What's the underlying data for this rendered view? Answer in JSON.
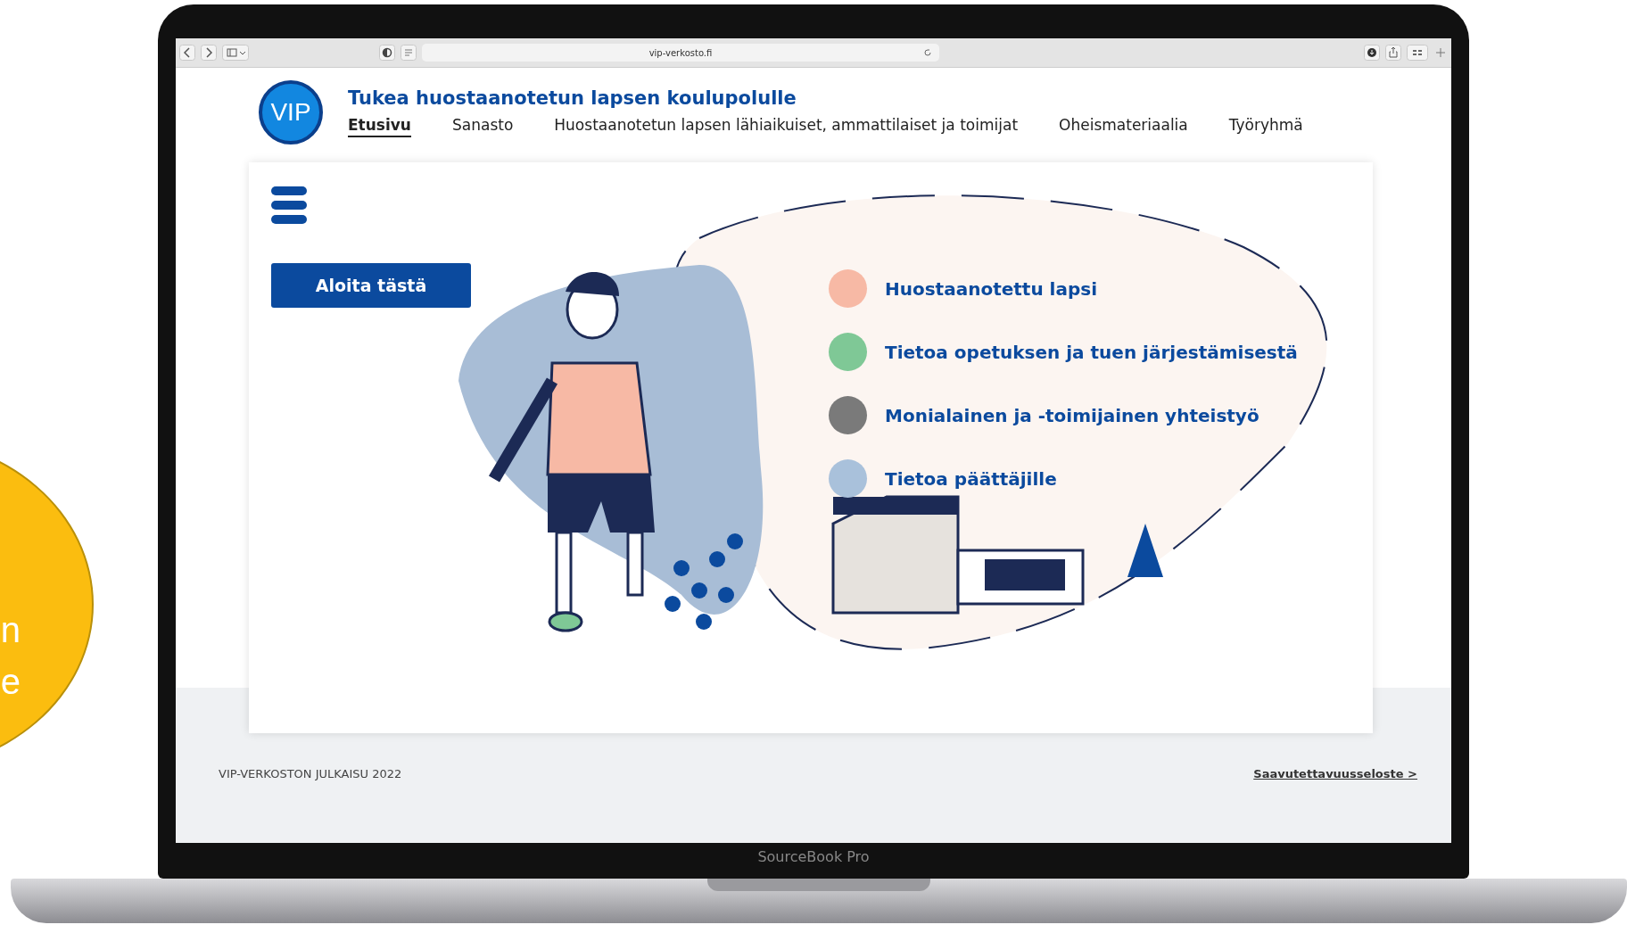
{
  "browser": {
    "address": "vip-verkosto.fi"
  },
  "site": {
    "logo": "VIP",
    "title": "Tukea huostaanotetun lapsen koulupolulle"
  },
  "nav": [
    {
      "label": "Etusivu",
      "selected": true
    },
    {
      "label": "Sanasto",
      "selected": false
    },
    {
      "label": "Huostaanotetun lapsen lähiaikuiset, ammattilaiset ja toimijat",
      "selected": false
    },
    {
      "label": "Oheismateriaalia",
      "selected": false
    },
    {
      "label": "Työryhmä",
      "selected": false
    }
  ],
  "hero": {
    "button": "Aloita tästä",
    "topics": [
      {
        "label": "Huostaanotettu lapsi",
        "color": "#f7b9a5"
      },
      {
        "label": "Tietoa opetuksen ja tuen järjestämisestä",
        "color": "#7fc896"
      },
      {
        "label": "Monialainen ja -toimijainen yhteistyö",
        "color": "#7a7a7a"
      },
      {
        "label": "Tietoa päättäjille",
        "color": "#a9c1db"
      }
    ]
  },
  "footer": {
    "text": "VIP-VERKOSTON JULKAISU 2022",
    "link": "Saavutettavuusseloste >"
  },
  "laptop_label": "SourceBook Pro",
  "side_circle": {
    "lines": [
      "n",
      "e"
    ]
  }
}
